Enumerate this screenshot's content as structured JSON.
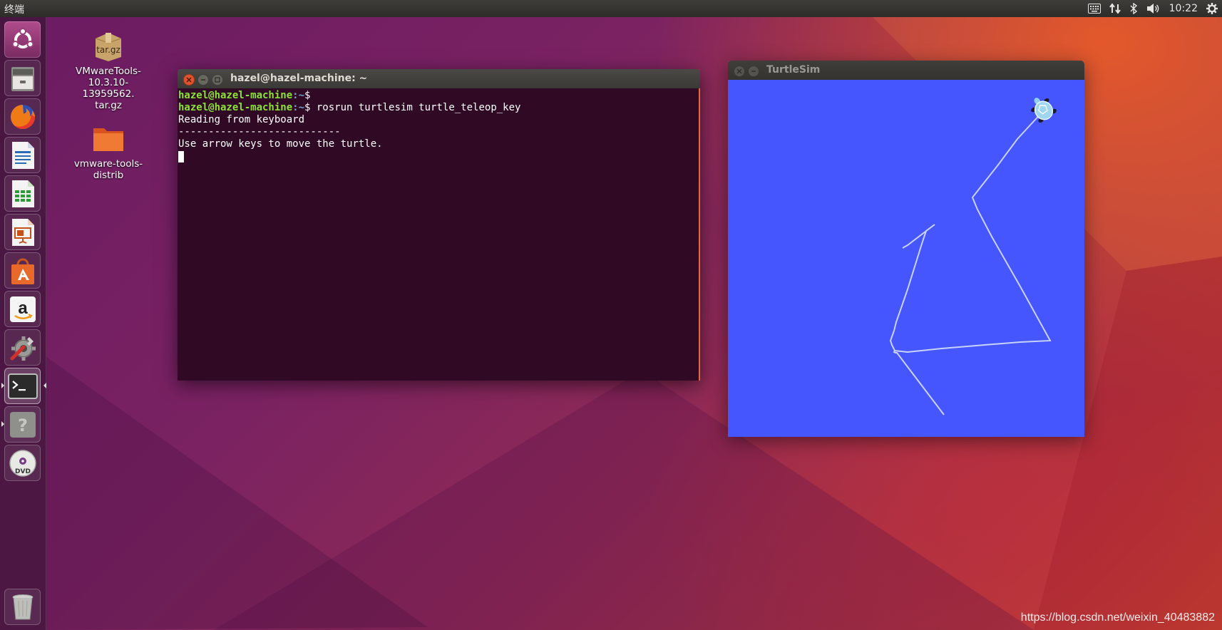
{
  "top_panel": {
    "app_title": "终端",
    "time": "10:22",
    "indicators": [
      "keyboard-icon",
      "network-transfer-icon",
      "bluetooth-icon",
      "volume-icon",
      "settings-gear-icon"
    ]
  },
  "launcher": {
    "items": [
      {
        "name": "ubuntu-dash"
      },
      {
        "name": "files"
      },
      {
        "name": "firefox"
      },
      {
        "name": "libreoffice-writer"
      },
      {
        "name": "libreoffice-calc"
      },
      {
        "name": "libreoffice-impress"
      },
      {
        "name": "ubuntu-software"
      },
      {
        "name": "amazon"
      },
      {
        "name": "system-settings"
      },
      {
        "name": "terminal"
      },
      {
        "name": "help"
      },
      {
        "name": "dvd"
      },
      {
        "name": "trash"
      }
    ]
  },
  "desktop": {
    "icons": [
      {
        "label": "VMwareTools-\n10.3.10-13959562.\ntar.gz",
        "badge": "tar.gz",
        "type": "archive"
      },
      {
        "label": "vmware-tools-\ndistrib",
        "type": "folder"
      }
    ]
  },
  "terminal": {
    "title": "hazel@hazel-machine: ~",
    "lines": [
      {
        "user": "hazel@hazel-machine",
        "path": ":~",
        "prompt": "$",
        "command": ""
      },
      {
        "user": "hazel@hazel-machine",
        "path": ":~",
        "prompt": "$",
        "command": " rosrun turtlesim turtle_teleop_key"
      },
      {
        "text": "Reading from keyboard"
      },
      {
        "text": "---------------------------"
      },
      {
        "text": "Use arrow keys to move the turtle."
      }
    ]
  },
  "turtlesim": {
    "title": "TurtleSim",
    "background_color": "#4556ff",
    "trail_color": "#c8d2ff"
  },
  "watermark": "https://blog.csdn.net/weixin_40483882",
  "colors": {
    "terminal_bg": "#300a24",
    "prompt_user": "#8ae234",
    "prompt_path": "#729fcf",
    "accent_orange": "#e95420"
  }
}
